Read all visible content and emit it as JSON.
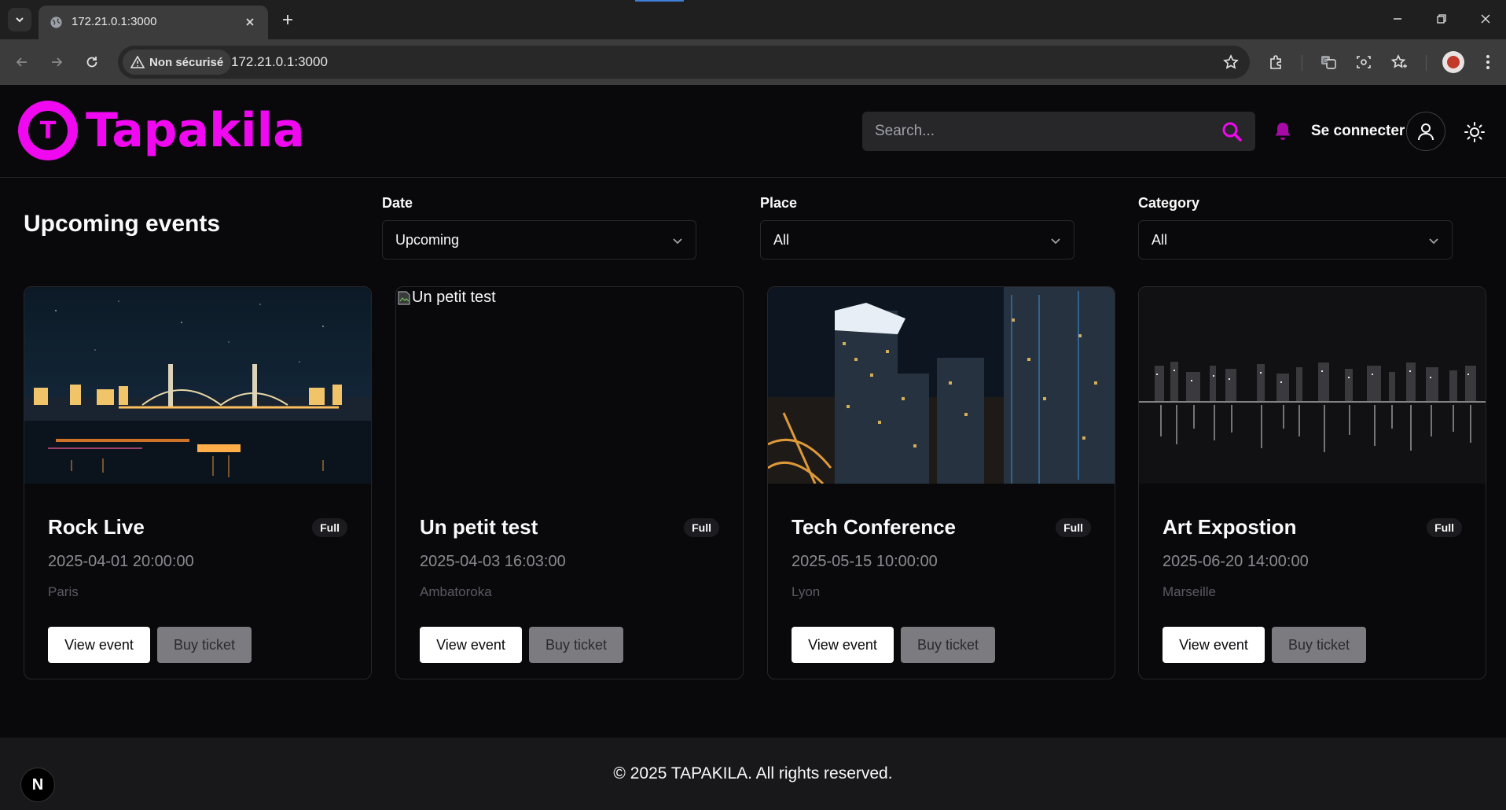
{
  "browser": {
    "tab_title": "172.21.0.1:3000",
    "security_label": "Non sécurisé",
    "url": "172.21.0.1:3000"
  },
  "header": {
    "logo_letter": "T",
    "logo_text": "Tapakila",
    "search_placeholder": "Search...",
    "signin_label": "Se connecter",
    "brand_color": "#f008f0"
  },
  "main": {
    "title": "Upcoming events",
    "filters": [
      {
        "label": "Date",
        "value": "Upcoming"
      },
      {
        "label": "Place",
        "value": "All"
      },
      {
        "label": "Category",
        "value": "All"
      }
    ]
  },
  "events": [
    {
      "title": "Rock Live",
      "status": "Full",
      "datetime": "2025-04-01 20:00:00",
      "place": "Paris",
      "image": "night-bridge-city",
      "image_alt": ""
    },
    {
      "title": "Un petit test",
      "status": "Full",
      "datetime": "2025-04-03 16:03:00",
      "place": "Ambatoroka",
      "image": "broken-image",
      "image_alt": "Un petit test"
    },
    {
      "title": "Tech Conference",
      "status": "Full",
      "datetime": "2025-05-15 10:00:00",
      "place": "Lyon",
      "image": "night-skyscrapers",
      "image_alt": ""
    },
    {
      "title": "Art Expostion",
      "status": "Full",
      "datetime": "2025-06-20 14:00:00",
      "place": "Marseille",
      "image": "monochrome-skyline",
      "image_alt": ""
    }
  ],
  "card_actions": {
    "view_label": "View event",
    "buy_label": "Buy ticket"
  },
  "footer": {
    "copyright": "© 2025 TAPAKILA. All rights reserved.",
    "dev_badge": "N"
  }
}
